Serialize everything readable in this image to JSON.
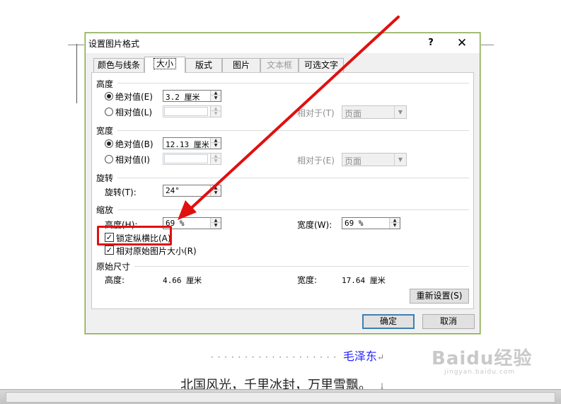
{
  "document": {
    "signature_dots": "· · · · · · · · · · · · · · · · · · ·",
    "signature_author": "毛泽东",
    "para_mark": "↵",
    "poem_line": "北国风光，千里冰封，万里雪飘。",
    "poem_mark": "↓",
    "watermark_main": "Baidu经验",
    "watermark_sub": "jingyan.baidu.com"
  },
  "dialog": {
    "title": "设置图片格式",
    "help_label": "?",
    "close_label": "✕",
    "tabs": [
      {
        "label": "颜色与线条",
        "state": "normal"
      },
      {
        "label": "大小",
        "state": "active"
      },
      {
        "label": "版式",
        "state": "normal"
      },
      {
        "label": "图片",
        "state": "normal"
      },
      {
        "label": "文本框",
        "state": "disabled"
      },
      {
        "label": "可选文字",
        "state": "normal"
      }
    ],
    "height": {
      "section": "高度",
      "absolute_label": "绝对值(E)",
      "absolute_value": "3.2 厘米",
      "relative_label": "相对值(L)",
      "relative_to_label": "相对于(T)",
      "relative_to_value": "页面"
    },
    "width": {
      "section": "宽度",
      "absolute_label": "绝对值(B)",
      "absolute_value": "12.13 厘米",
      "relative_label": "相对值(I)",
      "relative_to_label": "相对于(E)",
      "relative_to_value": "页面"
    },
    "rotation": {
      "section": "旋转",
      "label": "旋转(T):",
      "value": "24°"
    },
    "scale": {
      "section": "缩放",
      "height_label": "高度(H):",
      "height_value": "69 %",
      "width_label": "宽度(W):",
      "width_value": "69 %",
      "lock_aspect_label": "锁定纵横比(A)",
      "lock_aspect_checked": true,
      "relative_original_label": "相对原始图片大小(R)",
      "relative_original_checked": true
    },
    "original": {
      "section": "原始尺寸",
      "height_label": "高度:",
      "height_value": "4.66 厘米",
      "width_label": "宽度:",
      "width_value": "17.64 厘米",
      "reset_label": "重新设置(S)"
    },
    "ok_label": "确定",
    "cancel_label": "取消"
  },
  "annotation": {
    "arrow_color": "#e01010",
    "box_color": "#e01010"
  }
}
